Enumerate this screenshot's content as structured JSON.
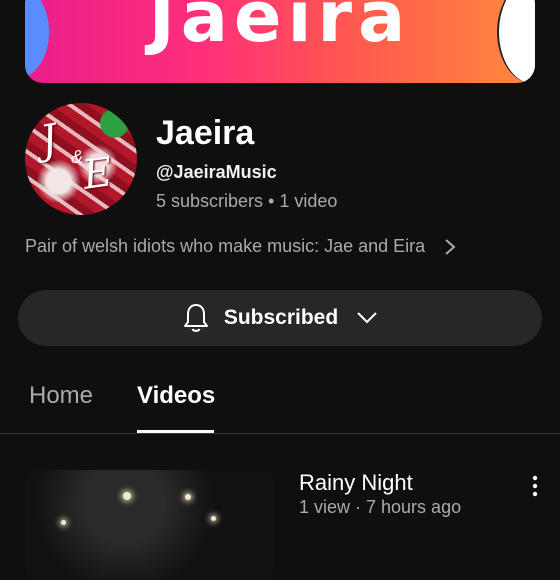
{
  "banner": {
    "text": "Jaeira"
  },
  "channel": {
    "name": "Jaeira",
    "handle": "@JaeiraMusic",
    "stats": "5 subscribers • 1 video",
    "about": "Pair of welsh idiots who make music: Jae and Eira",
    "avatar": {
      "letter_j": "J",
      "letter_amp": "&",
      "letter_e": "E"
    }
  },
  "subscribe": {
    "label": "Subscribed",
    "icon": "bell-icon"
  },
  "tabs": [
    {
      "label": "Home",
      "active": false
    },
    {
      "label": "Videos",
      "active": true
    }
  ],
  "videos": [
    {
      "title": "Rainy Night",
      "meta": "1 view · 7 hours ago"
    }
  ],
  "colors": {
    "background": "#0f0f0f",
    "button_bg": "#272727",
    "secondary_text": "#aaaaaa",
    "banner_gradient_start": "#e91e8c",
    "banner_gradient_end": "#ff8a3d"
  }
}
